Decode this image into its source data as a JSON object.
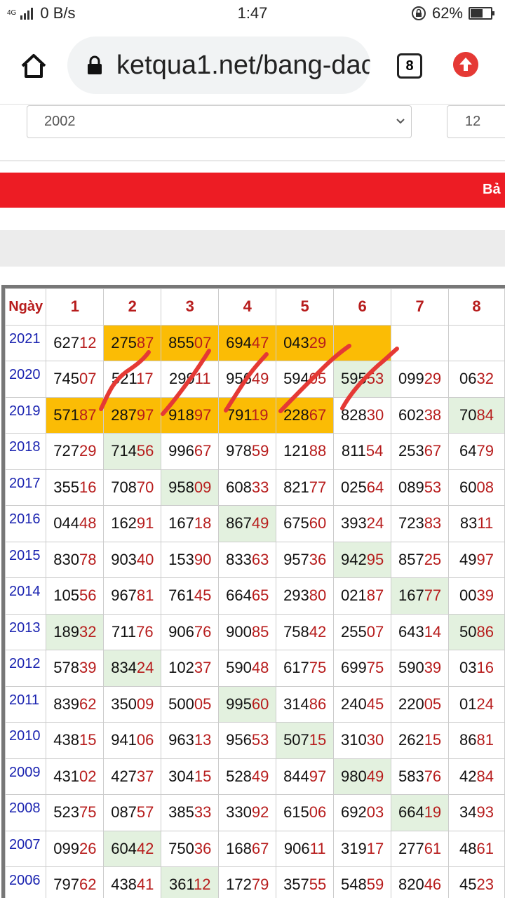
{
  "status": {
    "network_tag": "4G",
    "speed": "0 B/s",
    "time": "1:47",
    "battery": "62%",
    "battery_level": 0.62
  },
  "browser": {
    "url": "ketqua1.net/bang-dac",
    "tab_count": "8"
  },
  "filters": {
    "year_value": "2002",
    "month_value": "12"
  },
  "banner": {
    "text": "Bả"
  },
  "table": {
    "header_day": "Ngày",
    "columns": [
      "1",
      "2",
      "3",
      "4",
      "5",
      "6",
      "7",
      "8"
    ],
    "rows": [
      {
        "year": "2021",
        "cells": [
          {
            "v": "62712",
            "s": ""
          },
          {
            "v": "27587",
            "s": "hl"
          },
          {
            "v": "85507",
            "s": "hl"
          },
          {
            "v": "69447",
            "s": "hl"
          },
          {
            "v": "04329",
            "s": "hl"
          },
          {
            "v": "",
            "s": "hl"
          },
          {
            "v": "",
            "s": ""
          },
          {
            "v": "",
            "s": ""
          }
        ]
      },
      {
        "year": "2020",
        "cells": [
          {
            "v": "74507",
            "s": ""
          },
          {
            "v": "52117",
            "s": ""
          },
          {
            "v": "29911",
            "s": ""
          },
          {
            "v": "95649",
            "s": ""
          },
          {
            "v": "59405",
            "s": ""
          },
          {
            "v": "59553",
            "s": "gr"
          },
          {
            "v": "09929",
            "s": ""
          },
          {
            "v": "0632",
            "s": ""
          }
        ]
      },
      {
        "year": "2019",
        "cells": [
          {
            "v": "57187",
            "s": "hl"
          },
          {
            "v": "28797",
            "s": "hl"
          },
          {
            "v": "91897",
            "s": "hl"
          },
          {
            "v": "79119",
            "s": "hl"
          },
          {
            "v": "22867",
            "s": "hl"
          },
          {
            "v": "82830",
            "s": ""
          },
          {
            "v": "60238",
            "s": ""
          },
          {
            "v": "7084",
            "s": "gr"
          }
        ]
      },
      {
        "year": "2018",
        "cells": [
          {
            "v": "72729",
            "s": ""
          },
          {
            "v": "71456",
            "s": "gr"
          },
          {
            "v": "99667",
            "s": ""
          },
          {
            "v": "97859",
            "s": ""
          },
          {
            "v": "12188",
            "s": ""
          },
          {
            "v": "81154",
            "s": ""
          },
          {
            "v": "25367",
            "s": ""
          },
          {
            "v": "6479",
            "s": ""
          }
        ]
      },
      {
        "year": "2017",
        "cells": [
          {
            "v": "35516",
            "s": ""
          },
          {
            "v": "70870",
            "s": ""
          },
          {
            "v": "95809",
            "s": "gr"
          },
          {
            "v": "60833",
            "s": ""
          },
          {
            "v": "82177",
            "s": ""
          },
          {
            "v": "02564",
            "s": ""
          },
          {
            "v": "08953",
            "s": ""
          },
          {
            "v": "6008",
            "s": ""
          }
        ]
      },
      {
        "year": "2016",
        "cells": [
          {
            "v": "04448",
            "s": ""
          },
          {
            "v": "16291",
            "s": ""
          },
          {
            "v": "16718",
            "s": ""
          },
          {
            "v": "86749",
            "s": "gr"
          },
          {
            "v": "67560",
            "s": ""
          },
          {
            "v": "39324",
            "s": ""
          },
          {
            "v": "72383",
            "s": ""
          },
          {
            "v": "8311",
            "s": ""
          }
        ]
      },
      {
        "year": "2015",
        "cells": [
          {
            "v": "83078",
            "s": ""
          },
          {
            "v": "90340",
            "s": ""
          },
          {
            "v": "15390",
            "s": ""
          },
          {
            "v": "83363",
            "s": ""
          },
          {
            "v": "95736",
            "s": ""
          },
          {
            "v": "94295",
            "s": "gr"
          },
          {
            "v": "85725",
            "s": ""
          },
          {
            "v": "4997",
            "s": ""
          }
        ]
      },
      {
        "year": "2014",
        "cells": [
          {
            "v": "10556",
            "s": ""
          },
          {
            "v": "96781",
            "s": ""
          },
          {
            "v": "76145",
            "s": ""
          },
          {
            "v": "66465",
            "s": ""
          },
          {
            "v": "29380",
            "s": ""
          },
          {
            "v": "02187",
            "s": ""
          },
          {
            "v": "16777",
            "s": "gr"
          },
          {
            "v": "0039",
            "s": ""
          }
        ]
      },
      {
        "year": "2013",
        "cells": [
          {
            "v": "18932",
            "s": "gr"
          },
          {
            "v": "71176",
            "s": ""
          },
          {
            "v": "90676",
            "s": ""
          },
          {
            "v": "90085",
            "s": ""
          },
          {
            "v": "75842",
            "s": ""
          },
          {
            "v": "25507",
            "s": ""
          },
          {
            "v": "64314",
            "s": ""
          },
          {
            "v": "5086",
            "s": "gr"
          }
        ]
      },
      {
        "year": "2012",
        "cells": [
          {
            "v": "57839",
            "s": ""
          },
          {
            "v": "83424",
            "s": "gr"
          },
          {
            "v": "10237",
            "s": ""
          },
          {
            "v": "59048",
            "s": ""
          },
          {
            "v": "61775",
            "s": ""
          },
          {
            "v": "69975",
            "s": ""
          },
          {
            "v": "59039",
            "s": ""
          },
          {
            "v": "0316",
            "s": ""
          }
        ]
      },
      {
        "year": "2011",
        "cells": [
          {
            "v": "83962",
            "s": ""
          },
          {
            "v": "35009",
            "s": ""
          },
          {
            "v": "50005",
            "s": ""
          },
          {
            "v": "99560",
            "s": "gr"
          },
          {
            "v": "31486",
            "s": ""
          },
          {
            "v": "24045",
            "s": ""
          },
          {
            "v": "22005",
            "s": ""
          },
          {
            "v": "0124",
            "s": ""
          }
        ]
      },
      {
        "year": "2010",
        "cells": [
          {
            "v": "43815",
            "s": ""
          },
          {
            "v": "94106",
            "s": ""
          },
          {
            "v": "96313",
            "s": ""
          },
          {
            "v": "95653",
            "s": ""
          },
          {
            "v": "50715",
            "s": "gr"
          },
          {
            "v": "31030",
            "s": ""
          },
          {
            "v": "26215",
            "s": ""
          },
          {
            "v": "8681",
            "s": ""
          }
        ]
      },
      {
        "year": "2009",
        "cells": [
          {
            "v": "43102",
            "s": ""
          },
          {
            "v": "42737",
            "s": ""
          },
          {
            "v": "30415",
            "s": ""
          },
          {
            "v": "52849",
            "s": ""
          },
          {
            "v": "84497",
            "s": ""
          },
          {
            "v": "98049",
            "s": "gr"
          },
          {
            "v": "58376",
            "s": ""
          },
          {
            "v": "4284",
            "s": ""
          }
        ]
      },
      {
        "year": "2008",
        "cells": [
          {
            "v": "52375",
            "s": ""
          },
          {
            "v": "08757",
            "s": ""
          },
          {
            "v": "38533",
            "s": ""
          },
          {
            "v": "33092",
            "s": ""
          },
          {
            "v": "61506",
            "s": ""
          },
          {
            "v": "69203",
            "s": ""
          },
          {
            "v": "66419",
            "s": "gr"
          },
          {
            "v": "3493",
            "s": ""
          }
        ]
      },
      {
        "year": "2007",
        "cells": [
          {
            "v": "09926",
            "s": ""
          },
          {
            "v": "60442",
            "s": "gr"
          },
          {
            "v": "75036",
            "s": ""
          },
          {
            "v": "16867",
            "s": ""
          },
          {
            "v": "90611",
            "s": ""
          },
          {
            "v": "31917",
            "s": ""
          },
          {
            "v": "27761",
            "s": ""
          },
          {
            "v": "4861",
            "s": ""
          }
        ]
      },
      {
        "year": "2006",
        "cells": [
          {
            "v": "79762",
            "s": ""
          },
          {
            "v": "43841",
            "s": ""
          },
          {
            "v": "36112",
            "s": "gr"
          },
          {
            "v": "17279",
            "s": ""
          },
          {
            "v": "35755",
            "s": ""
          },
          {
            "v": "54859",
            "s": ""
          },
          {
            "v": "82046",
            "s": ""
          },
          {
            "v": "4523",
            "s": ""
          }
        ]
      }
    ]
  },
  "colors": {
    "highlight": "#fbbc05",
    "green_cell": "#e3f1df",
    "tail_digits": "#b71c1c",
    "year_text": "#1a23b0",
    "banner": "#ed1c24",
    "annotation": "#e53935"
  },
  "icons": [
    "home-icon",
    "lock-icon",
    "tabs-icon",
    "upload-icon",
    "chevron-down-icon",
    "signal-icon",
    "battery-icon",
    "rotation-lock-icon"
  ]
}
